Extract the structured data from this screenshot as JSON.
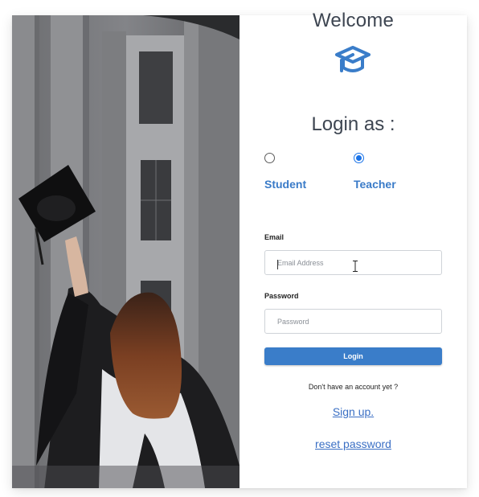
{
  "form": {
    "welcome": "Welcome",
    "login_as": "Login as :",
    "roles": [
      {
        "label": "Student",
        "selected": false
      },
      {
        "label": "Teacher",
        "selected": true
      }
    ],
    "email": {
      "label": "Email",
      "placeholder": "Email Address",
      "value": ""
    },
    "password": {
      "label": "Password",
      "placeholder": "Password",
      "value": ""
    },
    "login_button": "Login",
    "no_account_text": "Don't have an account yet ?",
    "sign_up_link": "Sign up.",
    "reset_password_link": "reset password"
  },
  "icons": {
    "logo": "graduation-cap-icon"
  },
  "colors": {
    "accent": "#3a7dc9",
    "link": "#3a6fc4",
    "heading": "#3d4551",
    "radio_checked": "#1a73e8"
  }
}
